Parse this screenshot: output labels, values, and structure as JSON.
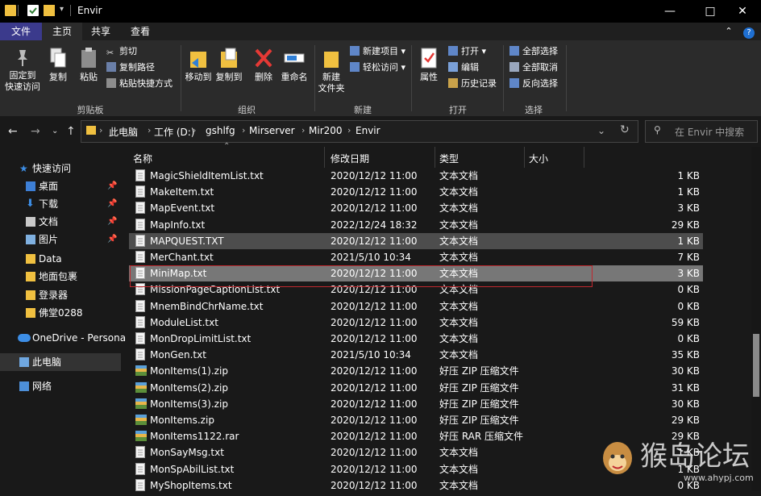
{
  "window": {
    "title": "Envir",
    "controls": [
      "minimize-icon",
      "maximize-icon",
      "close-icon"
    ]
  },
  "tabs": [
    {
      "label": "文件"
    },
    {
      "label": "主页"
    },
    {
      "label": "共享"
    },
    {
      "label": "查看"
    }
  ],
  "ribbon": {
    "pin_quick": "固定到\n快速访问",
    "copy": "复制",
    "paste": "粘贴",
    "cut": "剪切",
    "copy_path": "复制路径",
    "paste_shortcut": "粘贴快捷方式",
    "move_to": "移动到",
    "copy_to": "复制到",
    "delete": "删除",
    "rename": "重命名",
    "new_folder": "新建\n文件夹",
    "new_item": "新建项目",
    "easy_access": "轻松访问",
    "properties": "属性",
    "open": "打开",
    "edit": "编辑",
    "history": "历史记录",
    "select_all": "全部选择",
    "select_none": "全部取消",
    "invert": "反向选择",
    "groups": {
      "clipboard": "剪贴板",
      "organize": "组织",
      "new": "新建",
      "open": "打开",
      "select": "选择"
    }
  },
  "address": {
    "crumbs": [
      "此电脑",
      "工作 (D:)",
      "gshlfg",
      "Mirserver",
      "Mir200",
      "Envir"
    ],
    "search_placeholder": "在 Envir 中搜索"
  },
  "sidebar": {
    "items": [
      {
        "label": "快速访问",
        "icon": "star-icon"
      },
      {
        "label": "桌面",
        "icon": "desktop-icon",
        "pinned": true
      },
      {
        "label": "下载",
        "icon": "download-icon",
        "pinned": true
      },
      {
        "label": "文档",
        "icon": "document-icon",
        "pinned": true
      },
      {
        "label": "图片",
        "icon": "picture-icon",
        "pinned": true
      },
      {
        "label": "Data",
        "icon": "folder-icon"
      },
      {
        "label": "地面包裹",
        "icon": "folder-icon"
      },
      {
        "label": "登录器",
        "icon": "folder-icon"
      },
      {
        "label": "佛堂0288",
        "icon": "folder-icon"
      },
      {
        "label": "OneDrive - Persona",
        "icon": "cloud-icon"
      },
      {
        "label": "此电脑",
        "icon": "computer-icon"
      },
      {
        "label": "网络",
        "icon": "network-icon"
      }
    ]
  },
  "columns": {
    "name": "名称",
    "modified": "修改日期",
    "type": "类型",
    "size": "大小"
  },
  "files": [
    {
      "name": "MagicShieldItemList.txt",
      "date": "2020/12/12 11:00",
      "type": "文本文档",
      "size": "1 KB",
      "kind": "txt"
    },
    {
      "name": "MakeItem.txt",
      "date": "2020/12/12 11:00",
      "type": "文本文档",
      "size": "1 KB",
      "kind": "txt"
    },
    {
      "name": "MapEvent.txt",
      "date": "2020/12/12 11:00",
      "type": "文本文档",
      "size": "3 KB",
      "kind": "txt"
    },
    {
      "name": "MapInfo.txt",
      "date": "2022/12/24 18:32",
      "type": "文本文档",
      "size": "29 KB",
      "kind": "txt"
    },
    {
      "name": "MAPQUEST.TXT",
      "date": "2020/12/12 11:00",
      "type": "文本文档",
      "size": "1 KB",
      "kind": "txt",
      "state": "hover"
    },
    {
      "name": "MerChant.txt",
      "date": "2021/5/10 10:34",
      "type": "文本文档",
      "size": "7 KB",
      "kind": "txt"
    },
    {
      "name": "MiniMap.txt",
      "date": "2020/12/12 11:00",
      "type": "文本文档",
      "size": "3 KB",
      "kind": "txt",
      "state": "selected"
    },
    {
      "name": "MissionPageCaptionList.txt",
      "date": "2020/12/12 11:00",
      "type": "文本文档",
      "size": "0 KB",
      "kind": "txt"
    },
    {
      "name": "MnemBindChrName.txt",
      "date": "2020/12/12 11:00",
      "type": "文本文档",
      "size": "0 KB",
      "kind": "txt"
    },
    {
      "name": "ModuleList.txt",
      "date": "2020/12/12 11:00",
      "type": "文本文档",
      "size": "59 KB",
      "kind": "txt"
    },
    {
      "name": "MonDropLimitList.txt",
      "date": "2020/12/12 11:00",
      "type": "文本文档",
      "size": "0 KB",
      "kind": "txt"
    },
    {
      "name": "MonGen.txt",
      "date": "2021/5/10 10:34",
      "type": "文本文档",
      "size": "35 KB",
      "kind": "txt"
    },
    {
      "name": "MonItems(1).zip",
      "date": "2020/12/12 11:00",
      "type": "好压 ZIP 压缩文件",
      "size": "30 KB",
      "kind": "zip"
    },
    {
      "name": "MonItems(2).zip",
      "date": "2020/12/12 11:00",
      "type": "好压 ZIP 压缩文件",
      "size": "31 KB",
      "kind": "zip"
    },
    {
      "name": "MonItems(3).zip",
      "date": "2020/12/12 11:00",
      "type": "好压 ZIP 压缩文件",
      "size": "30 KB",
      "kind": "zip"
    },
    {
      "name": "MonItems.zip",
      "date": "2020/12/12 11:00",
      "type": "好压 ZIP 压缩文件",
      "size": "29 KB",
      "kind": "zip"
    },
    {
      "name": "MonItems1122.rar",
      "date": "2020/12/12 11:00",
      "type": "好压 RAR 压缩文件",
      "size": "29 KB",
      "kind": "zip"
    },
    {
      "name": "MonSayMsg.txt",
      "date": "2020/12/12 11:00",
      "type": "文本文档",
      "size": "1 KB",
      "kind": "txt"
    },
    {
      "name": "MonSpAbilList.txt",
      "date": "2020/12/12 11:00",
      "type": "文本文档",
      "size": "1 KB",
      "kind": "txt"
    },
    {
      "name": "MyShopItems.txt",
      "date": "2020/12/12 11:00",
      "type": "文本文档",
      "size": "0 KB",
      "kind": "txt"
    }
  ],
  "watermark": {
    "brand": "猴岛论坛",
    "url": "www.ahypj.com"
  },
  "colors": {
    "accent_tab": "#3b3a8c",
    "selection_red": "#c0282e",
    "folder": "#f0c040"
  }
}
